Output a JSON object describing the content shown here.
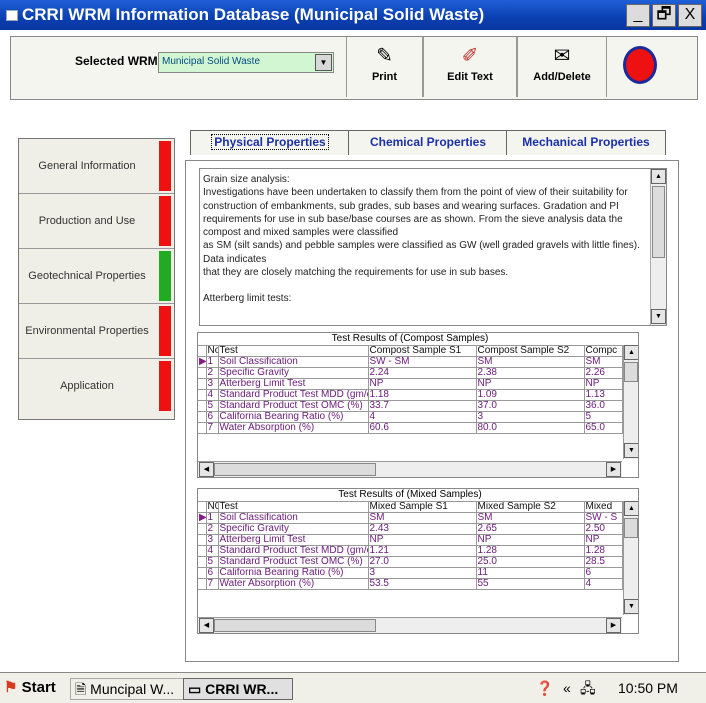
{
  "window": {
    "title": "CRRI WRM Information Database (Municipal Solid Waste)",
    "buttons": {
      "minimize": "_",
      "maximize": "🗗",
      "close": "X"
    }
  },
  "toolbar": {
    "selected_label": "Selected  WRM ›",
    "selected_value": "Municipal Solid Waste",
    "print_label": "Print",
    "edit_label": "Edit Text",
    "add_label": "Add/Delete",
    "print_icon": "print-icon",
    "edit_icon": "edit-icon",
    "add_icon": "add-delete-icon"
  },
  "sidebar": {
    "items": [
      {
        "label": "General Information",
        "status_color": "#ee1111"
      },
      {
        "label": "Production and Use",
        "status_color": "#ee1111"
      },
      {
        "label": "Geotechnical Properties",
        "status_color": "#22aa22"
      },
      {
        "label": "Environmental Properties",
        "status_color": "#ee1111"
      },
      {
        "label": "Application",
        "status_color": "#ee1111"
      }
    ]
  },
  "tabs": [
    {
      "label": "Physical Properties",
      "active": true
    },
    {
      "label": "Chemical Properties",
      "active": false
    },
    {
      "label": "Mechanical Properties",
      "active": false
    }
  ],
  "description": {
    "paragraphs": [
      "Grain size analysis:",
      "Investigations have been undertaken to classify them from the point of view of their suitability for construction of embankments, sub grades, sub bases and wearing surfaces. Gradation and PI requirements for use in sub base/base courses are as shown. From the sieve analysis data the compost and mixed samples were classified",
      "as SM (silt sands) and pebble samples were classified as GW (well graded gravels with little fines). Data indicates",
      "that they are closely matching the requirements for use in sub bases.",
      "",
      "Atterberg limit tests:"
    ]
  },
  "compost_table": {
    "caption": "Test Results of (Compost Samples)",
    "headers": [
      "No",
      "Test",
      "Compost Sample S1",
      "Compost Sample S2",
      "Compc"
    ],
    "rows": [
      [
        "1",
        "Soil Classification",
        "SW - SM",
        "SM",
        "SM"
      ],
      [
        "2",
        "Specific Gravity",
        "2.24",
        "2.38",
        "2.26"
      ],
      [
        "3",
        "Atterberg Limit Test",
        "NP",
        "NP",
        "NP"
      ],
      [
        "4",
        "Standard Product Test MDD (gm/cc)",
        "1.18",
        "1.09",
        "1.13"
      ],
      [
        "5",
        "Standard Product Test OMC (%)",
        "33.7",
        "37.0",
        "36.0"
      ],
      [
        "6",
        "California Bearing Ratio (%)",
        "4",
        "3",
        "5"
      ],
      [
        "7",
        "Water Absorption (%)",
        "60.6",
        "80.0",
        "65.0"
      ]
    ]
  },
  "mixed_table": {
    "caption": "Test Results of (Mixed Samples)",
    "headers": [
      "N0",
      "Test",
      "Mixed Sample S1",
      "Mixed Sample S2",
      "Mixed"
    ],
    "rows": [
      [
        "1",
        "Soil Classification",
        "SM",
        "SM",
        "SW - S"
      ],
      [
        "2",
        "Specific Gravity",
        "2.43",
        "2.65",
        "2.50"
      ],
      [
        "3",
        "Atterberg Limit Test",
        "NP",
        "NP",
        "NP"
      ],
      [
        "4",
        "Standard Product Test MDD (gm/cc)",
        "1.21",
        "1.28",
        "1.28"
      ],
      [
        "5",
        "Standard Product Test OMC (%)",
        "27.0",
        "25.0",
        "28.5"
      ],
      [
        "6",
        "California Bearing Ratio (%)",
        "3",
        "11",
        "6"
      ],
      [
        "7",
        "Water Absorption (%)",
        "53.5",
        "55",
        "4"
      ]
    ]
  },
  "taskbar": {
    "start": "Start",
    "items": [
      "Muncipal W...",
      "CRRI WR..."
    ],
    "time": "10:50 PM"
  }
}
